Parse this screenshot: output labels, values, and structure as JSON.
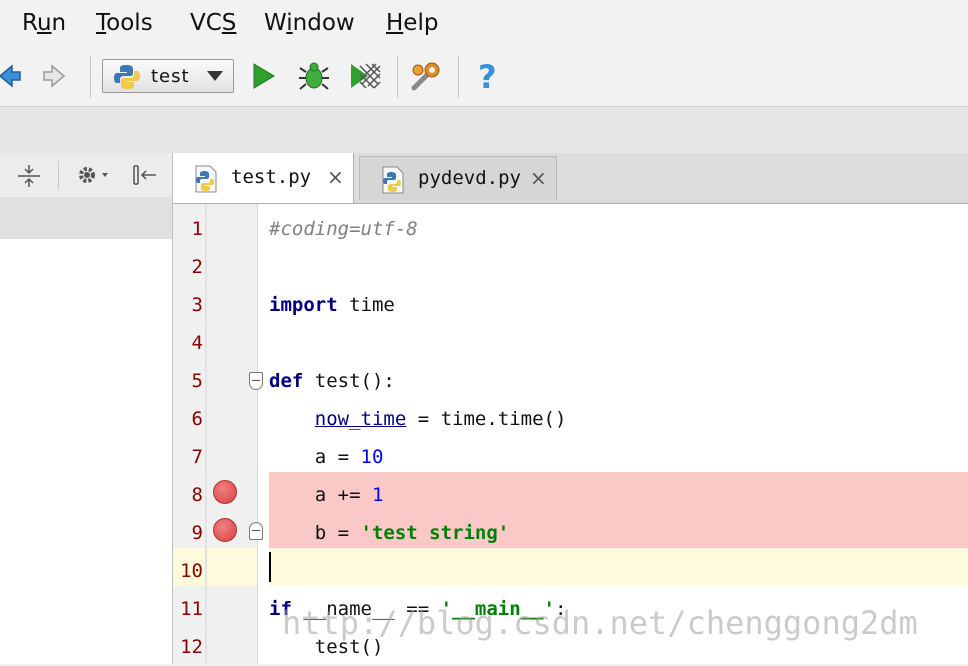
{
  "menu": {
    "items": [
      {
        "pre": "R",
        "u": "u",
        "post": "n"
      },
      {
        "pre": "",
        "u": "T",
        "post": "ools"
      },
      {
        "pre": "VC",
        "u": "S",
        "post": ""
      },
      {
        "pre": "W",
        "u": "i",
        "post": "ndow"
      },
      {
        "pre": "",
        "u": "H",
        "post": "elp"
      }
    ]
  },
  "toolbar": {
    "run_config_label": "test",
    "icons": [
      "back-arrow-icon",
      "forward-arrow-icon",
      "python-icon",
      "run-icon",
      "debug-icon",
      "coverage-icon",
      "settings-wrench-icon",
      "help-icon"
    ]
  },
  "tabs": [
    {
      "label": "test.py",
      "close": "×"
    },
    {
      "label": "pydevd.py",
      "close": "×"
    }
  ],
  "colors": {
    "breakpoint_line": "#fbc8c8",
    "current_line": "#fdfbdc",
    "keyword": "#000080",
    "string": "#008000",
    "comment": "#808080",
    "line_number": "#8b0000"
  },
  "editor": {
    "lines": [
      {
        "no": "1",
        "text": "#coding=utf-8"
      },
      {
        "no": "2",
        "text": ""
      },
      {
        "no": "3",
        "text": "import time"
      },
      {
        "no": "4",
        "text": ""
      },
      {
        "no": "5",
        "text": "def test():"
      },
      {
        "no": "6",
        "text": "    now_time = time.time()"
      },
      {
        "no": "7",
        "text": "    a = 10"
      },
      {
        "no": "8",
        "text": "    a += 1"
      },
      {
        "no": "9",
        "text": "    b = 'test string'"
      },
      {
        "no": "10",
        "text": ""
      },
      {
        "no": "11",
        "text": "if __name__ == '__main__':"
      },
      {
        "no": "12",
        "text": "    test()"
      }
    ],
    "breakpoint_lines": [
      "8",
      "9"
    ],
    "current_line": "10"
  },
  "watermark": "http://blog.csdn.net/chenggong2dm"
}
